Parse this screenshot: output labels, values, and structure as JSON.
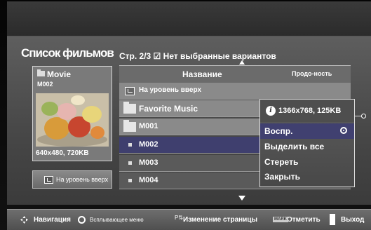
{
  "title": "Список фильмов",
  "page_info": "Стр. 2/3 ☑ Нет выбранные вариантов",
  "preview": {
    "name": "Movie",
    "code": "M002",
    "resolution": "640x480, 720KB"
  },
  "up_button": "На уровень вверх",
  "list": {
    "header_name": "Название",
    "header_duration": "Продо-ность",
    "rows": [
      {
        "label": "На уровень вверх"
      },
      {
        "label": "Favorite Music"
      },
      {
        "label": "M001"
      },
      {
        "label": "M002"
      },
      {
        "label": "M003"
      },
      {
        "label": "M004"
      }
    ]
  },
  "popup": {
    "info": "1366x768, 125KB",
    "items": [
      {
        "label": "Воспр."
      },
      {
        "label": "Выделить все"
      },
      {
        "label": "Стереть"
      },
      {
        "label": "Закрыть"
      }
    ]
  },
  "bottom": {
    "nav": "Навигация",
    "popup_menu": "Всплывающее меню",
    "page_change": "Изменение страницы",
    "mark_icon": "MARK",
    "mark": "Отметить",
    "exit": "Выход"
  },
  "colors": {
    "selected_row": "#3f3f6e",
    "panel": "#4d4d4d"
  }
}
